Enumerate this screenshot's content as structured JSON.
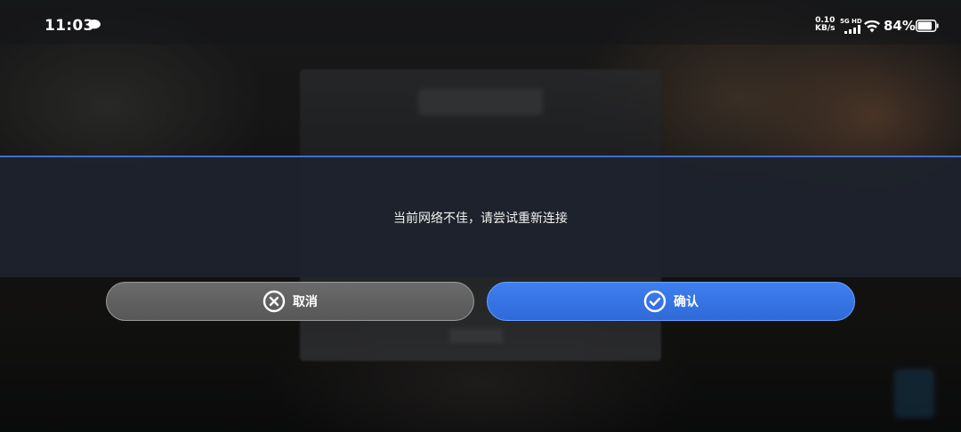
{
  "status_bar": {
    "time": "11:03",
    "net_speed_value": "0.10",
    "net_speed_unit": "KB/s",
    "network_label": "5G HD",
    "battery_percent": "84%",
    "battery_level": 0.84
  },
  "dialog": {
    "message": "当前网络不佳，请尝试重新连接",
    "accent_color": "#3e6fcf"
  },
  "buttons": {
    "cancel_label": "取消",
    "confirm_label": "确认",
    "cancel_icon": "close-circle-icon",
    "confirm_icon": "check-circle-icon",
    "confirm_color": "#3f7ff0",
    "cancel_color": "#6b6b6b"
  }
}
